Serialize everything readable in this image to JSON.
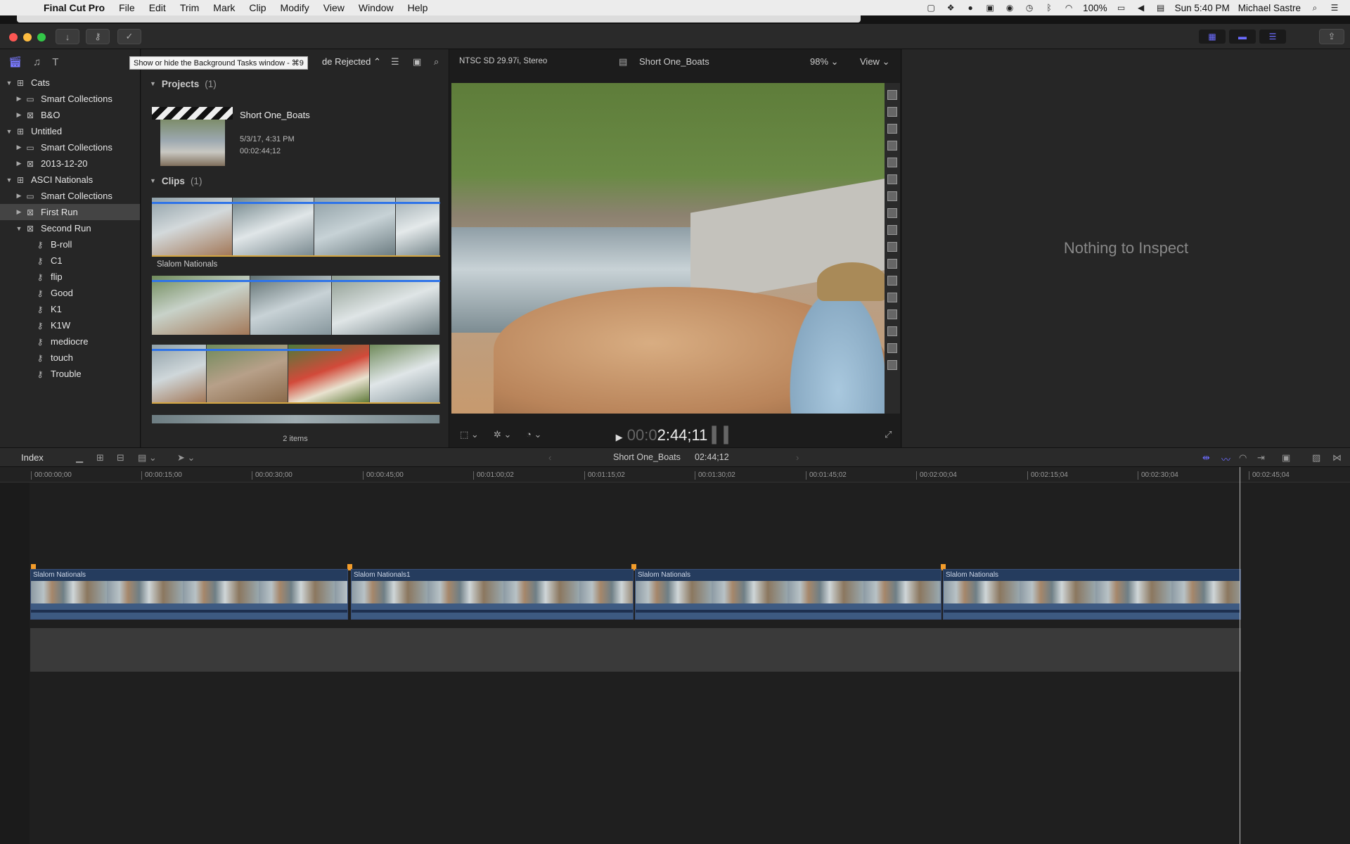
{
  "menubar": {
    "app": "Final Cut Pro",
    "menus": [
      "File",
      "Edit",
      "Trim",
      "Mark",
      "Clip",
      "Modify",
      "View",
      "Window",
      "Help"
    ],
    "battery": "100%",
    "clock": "Sun 5:40 PM",
    "user": "Michael Sastre"
  },
  "library": {
    "rows": [
      {
        "label": "Cats",
        "icon": "library-icon",
        "level": 0,
        "expanded": true
      },
      {
        "label": "Smart Collections",
        "icon": "folder-icon",
        "level": 1,
        "expanded": false
      },
      {
        "label": "B&O",
        "icon": "event-icon",
        "level": 1,
        "expanded": false
      },
      {
        "label": "Untitled",
        "icon": "library-icon",
        "level": 0,
        "expanded": true
      },
      {
        "label": "Smart Collections",
        "icon": "folder-icon",
        "level": 1,
        "expanded": false
      },
      {
        "label": "2013-12-20",
        "icon": "event-icon",
        "level": 1,
        "expanded": false
      },
      {
        "label": "ASCI Nationals",
        "icon": "library-icon",
        "level": 0,
        "expanded": true
      },
      {
        "label": "Smart Collections",
        "icon": "folder-icon",
        "level": 1,
        "expanded": false
      },
      {
        "label": "First Run",
        "icon": "event-icon",
        "level": 1,
        "expanded": false,
        "selected": true
      },
      {
        "label": "Second Run",
        "icon": "event-icon",
        "level": 1,
        "expanded": true
      },
      {
        "label": "B-roll",
        "icon": "keyword-icon",
        "level": 2
      },
      {
        "label": "C1",
        "icon": "keyword-icon",
        "level": 2
      },
      {
        "label": "flip",
        "icon": "keyword-icon",
        "level": 2
      },
      {
        "label": "Good",
        "icon": "keyword-icon",
        "level": 2
      },
      {
        "label": "K1",
        "icon": "keyword-icon",
        "level": 2
      },
      {
        "label": "K1W",
        "icon": "keyword-icon",
        "level": 2
      },
      {
        "label": "mediocre",
        "icon": "keyword-icon",
        "level": 2
      },
      {
        "label": "touch",
        "icon": "keyword-icon",
        "level": 2
      },
      {
        "label": "Trouble",
        "icon": "keyword-icon",
        "level": 2
      }
    ]
  },
  "browser": {
    "tooltip": "Show or hide the Background Tasks window - ⌘9",
    "filter": "de Rejected",
    "projects_label": "Projects",
    "projects_count": "(1)",
    "project": {
      "name": "Short One_Boats",
      "date": "5/3/17, 4:31 PM",
      "duration": "00:02:44;12"
    },
    "clips_label": "Clips",
    "clips_count": "(1)",
    "clip_name": "Slalom Nationals",
    "items": "2 items"
  },
  "viewer": {
    "format": "NTSC SD 29.97i, Stereo",
    "project": "Short One_Boats",
    "zoom": "98%",
    "view_label": "View",
    "timecode_dim": "00:0",
    "timecode": "2:44;11"
  },
  "inspector": {
    "message": "Nothing to Inspect"
  },
  "timeline": {
    "index_label": "Index",
    "project": "Short One_Boats",
    "duration": "02:44;12",
    "ruler": [
      "00:00:00;00",
      "00:00:15;00",
      "00:00:30;00",
      "00:00:45;00",
      "00:01:00;02",
      "00:01:15;02",
      "00:01:30;02",
      "00:01:45;02",
      "00:02:00;04",
      "00:02:15;04",
      "00:02:30;04",
      "00:02:45;04"
    ],
    "clips": [
      "Slalom Nationals",
      "Slalom Nationals1",
      "Slalom Nationals",
      "Slalom Nationals"
    ]
  },
  "colors": {
    "accent": "#6c6cff",
    "clip_blue": "#253c5e",
    "marker": "#f39c2a",
    "favorite": "#2f74e8",
    "rating": "#d4a642"
  }
}
